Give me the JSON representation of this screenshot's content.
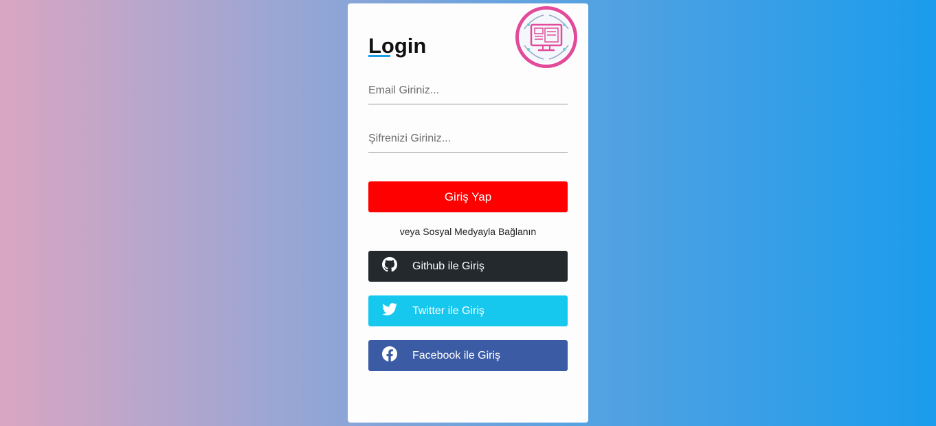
{
  "login": {
    "title": "Login",
    "email_placeholder": "Email Giriniz...",
    "password_placeholder": "Şifrenizi Giriniz...",
    "submit_label": "Giriş Yap",
    "social_prompt": "veya Sosyal Medyayla Bağlanın"
  },
  "social": {
    "github": {
      "label": "Github ile Giriş",
      "icon": "github-icon",
      "color": "#24292e"
    },
    "twitter": {
      "label": "Twitter ile Giriş",
      "icon": "twitter-icon",
      "color": "#16c8ee"
    },
    "facebook": {
      "label": "Facebook ile Giriş",
      "icon": "facebook-icon",
      "color": "#3b5ba5"
    }
  },
  "colors": {
    "accent": "#1b9cec",
    "submit": "#fe0000",
    "logo_ring": "#e24a9a"
  }
}
